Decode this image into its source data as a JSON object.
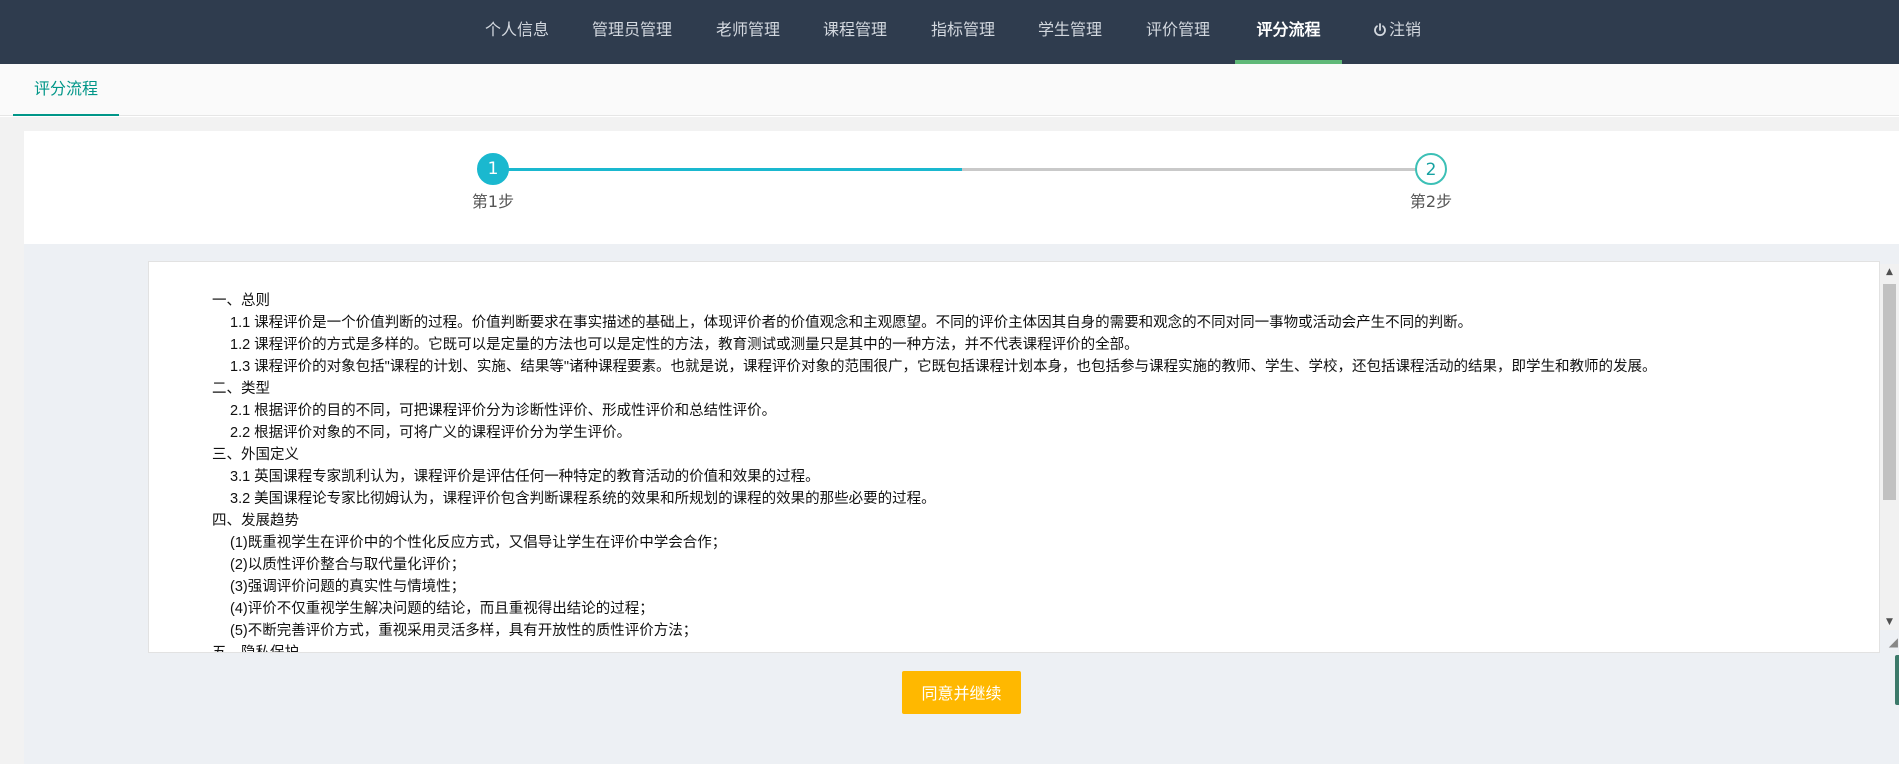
{
  "nav": {
    "items": [
      {
        "label": "个人信息"
      },
      {
        "label": "管理员管理"
      },
      {
        "label": "老师管理"
      },
      {
        "label": "课程管理"
      },
      {
        "label": "指标管理"
      },
      {
        "label": "学生管理"
      },
      {
        "label": "评价管理"
      },
      {
        "label": "评分流程",
        "active": true
      },
      {
        "label": "注销",
        "icon": "power-icon"
      }
    ],
    "active_color": "#5fb878",
    "background": "#2f3c4e"
  },
  "tab": {
    "label": "评分流程",
    "color": "#009688"
  },
  "steps": {
    "current": 1,
    "items": [
      {
        "number": "1",
        "label": "第1步",
        "state": "active"
      },
      {
        "number": "2",
        "label": "第2步",
        "state": "pending"
      }
    ],
    "progress_color": "#1ab8cf"
  },
  "content": {
    "lines": [
      {
        "text": "一、总则",
        "level": 0
      },
      {
        "text": "1.1 课程评价是一个价值判断的过程。价值判断要求在事实描述的基础上，体现评价者的价值观念和主观愿望。不同的评价主体因其自身的需要和观念的不同对同一事物或活动会产生不同的判断。",
        "level": 1
      },
      {
        "text": "1.2 课程评价的方式是多样的。它既可以是定量的方法也可以是定性的方法，教育测试或测量只是其中的一种方法，并不代表课程评价的全部。",
        "level": 1
      },
      {
        "text": "1.3 课程评价的对象包括\"课程的计划、实施、结果等\"诸种课程要素。也就是说，课程评价对象的范围很广，它既包括课程计划本身，也包括参与课程实施的教师、学生、学校，还包括课程活动的结果，即学生和教师的发展。",
        "level": 1
      },
      {
        "text": "二、类型",
        "level": 0
      },
      {
        "text": "2.1 根据评价的目的不同，可把课程评价分为诊断性评价、形成性评价和总结性评价。",
        "level": 1
      },
      {
        "text": "2.2 根据评价对象的不同，可将广义的课程评价分为学生评价。",
        "level": 1
      },
      {
        "text": "三、外国定义",
        "level": 0
      },
      {
        "text": "3.1 英国课程专家凯利认为，课程评价是评估任何一种特定的教育活动的价值和效果的过程。",
        "level": 1
      },
      {
        "text": "3.2 美国课程论专家比彻姆认为，课程评价包含判断课程系统的效果和所规划的课程的效果的那些必要的过程。",
        "level": 1
      },
      {
        "text": "四、发展趋势",
        "level": 0
      },
      {
        "text": "(1)既重视学生在评价中的个性化反应方式，又倡导让学生在评价中学会合作；",
        "level": 1
      },
      {
        "text": "(2)以质性评价整合与取代量化评价；",
        "level": 1
      },
      {
        "text": "(3)强调评价问题的真实性与情境性；",
        "level": 1
      },
      {
        "text": "(4)评价不仅重视学生解决问题的结论，而且重视得出结论的过程；",
        "level": 1
      },
      {
        "text": "(5)不断完善评价方式，重视采用灵活多样，具有开放性的质性评价方法；",
        "level": 1
      },
      {
        "text": "五、隐私保护",
        "level": 0
      }
    ]
  },
  "actions": {
    "agree_label": "同意并继续",
    "agree_color": "#ffb800"
  }
}
